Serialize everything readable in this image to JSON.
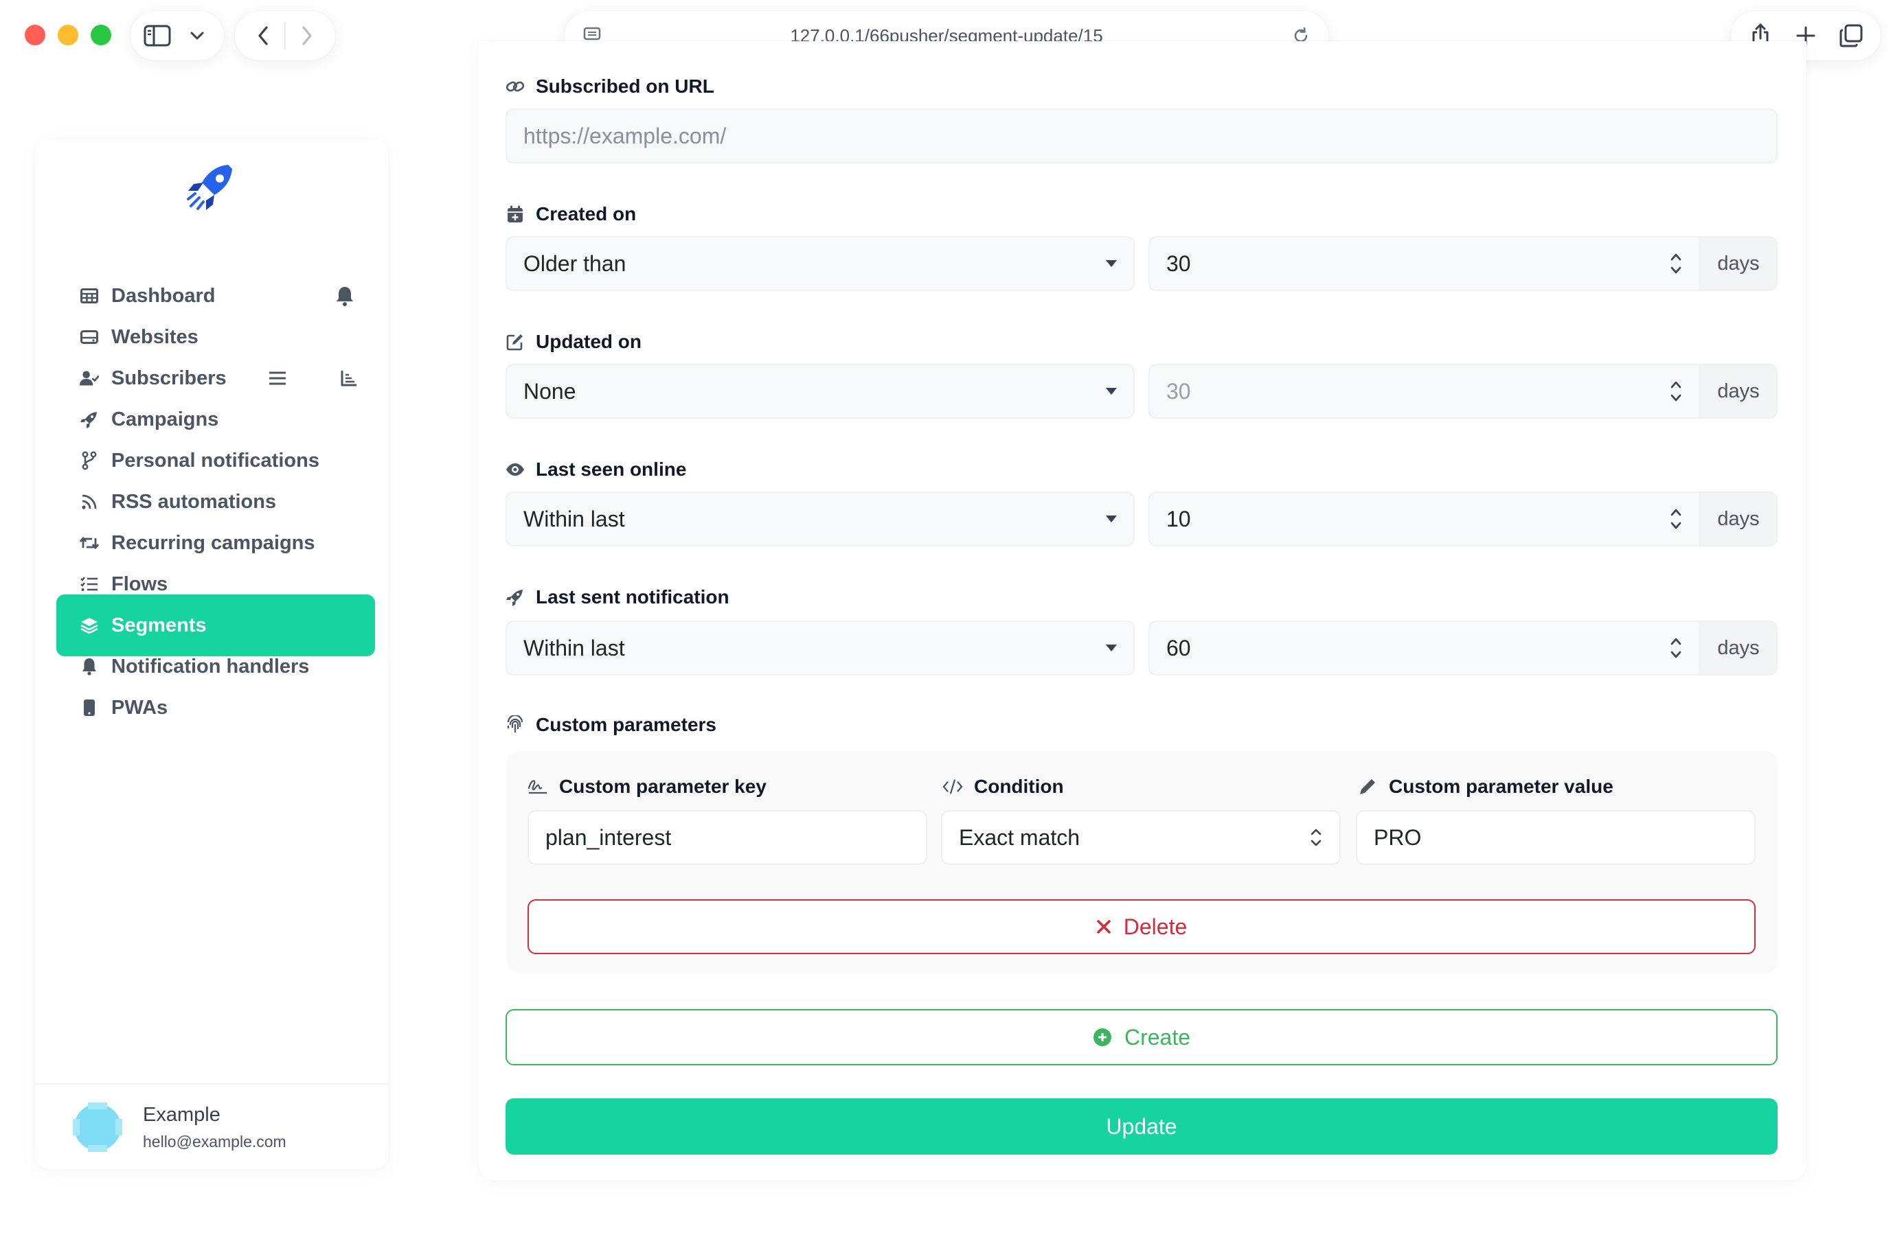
{
  "browser": {
    "url": "127.0.0.1/66pusher/segment-update/15",
    "traffic_colors": [
      "#ff5f57",
      "#febc2e",
      "#28c840"
    ]
  },
  "sidebar": {
    "items": [
      {
        "label": "Dashboard",
        "icon": "table-icon"
      },
      {
        "label": "Websites",
        "icon": "hdd-icon"
      },
      {
        "label": "Subscribers",
        "icon": "user-check-icon"
      },
      {
        "label": "Campaigns",
        "icon": "rocket-icon"
      },
      {
        "label": "Personal notifications",
        "icon": "code-branch-icon"
      },
      {
        "label": "RSS automations",
        "icon": "rss-icon"
      },
      {
        "label": "Recurring campaigns",
        "icon": "retweet-icon"
      },
      {
        "label": "Flows",
        "icon": "list-check-icon"
      },
      {
        "label": "Segments",
        "icon": "layer-group-icon",
        "active": true
      },
      {
        "label": "Notification handlers",
        "icon": "bell-icon"
      },
      {
        "label": "PWAs",
        "icon": "mobile-icon"
      }
    ],
    "user": {
      "name": "Example",
      "email": "hello@example.com"
    }
  },
  "form": {
    "subscribed_url": {
      "label": "Subscribed on URL",
      "placeholder": "https://example.com/"
    },
    "created_on": {
      "label": "Created on",
      "condition": "Older than",
      "value": "30",
      "unit": "days"
    },
    "updated_on": {
      "label": "Updated on",
      "condition": "None",
      "value": "30",
      "unit": "days"
    },
    "last_seen": {
      "label": "Last seen online",
      "condition": "Within last",
      "value": "10",
      "unit": "days"
    },
    "last_sent": {
      "label": "Last sent notification",
      "condition": "Within last",
      "value": "60",
      "unit": "days"
    },
    "custom_parameters": {
      "label": "Custom parameters",
      "key_label": "Custom parameter key",
      "condition_label": "Condition",
      "value_label": "Custom parameter value",
      "key": "plan_interest",
      "condition": "Exact match",
      "value": "PRO",
      "delete_label": "Delete"
    },
    "create_label": "Create",
    "update_label": "Update"
  },
  "colors": {
    "accent": "#16d3a0",
    "danger": "#d12d3d",
    "success": "#3cb55f"
  }
}
